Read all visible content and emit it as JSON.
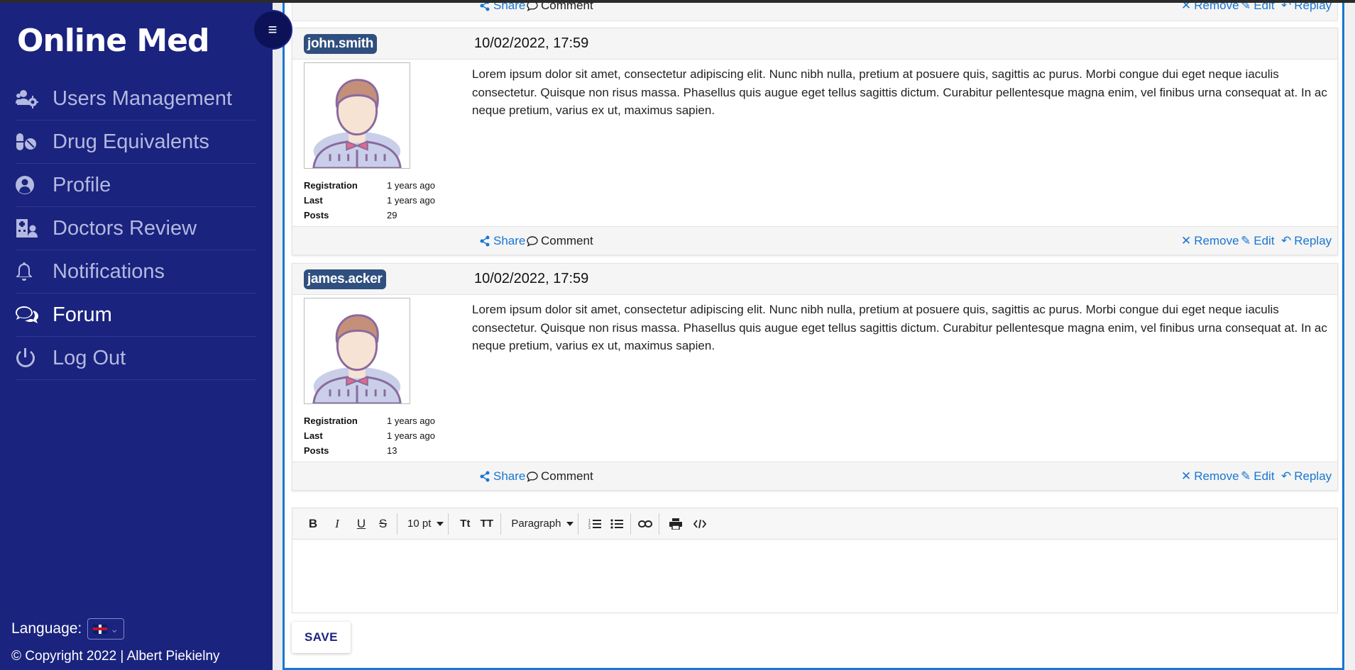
{
  "app": {
    "brand": "Online Med"
  },
  "sidebar": {
    "toggle_icon": "≡",
    "items": [
      {
        "label": "Users Management",
        "icon": "users-cog-icon"
      },
      {
        "label": "Drug Equivalents",
        "icon": "pills-icon"
      },
      {
        "label": "Profile",
        "icon": "user-circle-icon"
      },
      {
        "label": "Doctors Review",
        "icon": "clinic-icon"
      },
      {
        "label": "Notifications",
        "icon": "bell-icon"
      },
      {
        "label": "Forum",
        "icon": "comments-icon",
        "active": true
      },
      {
        "label": "Log Out",
        "icon": "power-icon"
      }
    ],
    "language_label": "Language:",
    "language_flag": "gb-flag-icon",
    "copyright": "© Copyright 2022 | Albert Piekielny"
  },
  "actions": {
    "share": "Share",
    "comment": "Comment",
    "remove": "Remove",
    "edit": "Edit",
    "reply": "Replay"
  },
  "posts": [
    {
      "username": "john.smith",
      "date": "10/02/2022, 17:59",
      "text": "Lorem ipsum dolor sit amet, consectetur adipiscing elit. Nunc nibh nulla, pretium at posuere quis, sagittis ac purus. Morbi congue dui eget neque iaculis consectetur. Quisque non risus massa. Phasellus quis augue eget tellus sagittis dictum. Curabitur pellentesque magna enim, vel finibus urna consequat at. In ac neque pretium, varius ex ut, maximus sapien.",
      "stats": [
        {
          "label": "Registration",
          "value": "1 years ago"
        },
        {
          "label": "Last",
          "value": "1 years ago"
        },
        {
          "label": "Posts",
          "value": "29"
        }
      ]
    },
    {
      "username": "james.acker",
      "date": "10/02/2022, 17:59",
      "text": "Lorem ipsum dolor sit amet, consectetur adipiscing elit. Nunc nibh nulla, pretium at posuere quis, sagittis ac purus. Morbi congue dui eget neque iaculis consectetur. Quisque non risus massa. Phasellus quis augue eget tellus sagittis dictum. Curabitur pellentesque magna enim, vel finibus urna consequat at. In ac neque pretium, varius ex ut, maximus sapien.",
      "stats": [
        {
          "label": "Registration",
          "value": "1 years ago"
        },
        {
          "label": "Last",
          "value": "1 years ago"
        },
        {
          "label": "Posts",
          "value": "13"
        }
      ]
    }
  ],
  "editor": {
    "bold": "B",
    "italic": "I",
    "underline": "U",
    "strike": "S",
    "font_size": "10 pt",
    "subscript": "Tt",
    "superscript": "TT",
    "block_format": "Paragraph",
    "value": ""
  },
  "save_label": "SAVE",
  "colors": {
    "sidebar": "#1a237e",
    "accent": "#1976d2",
    "username_badge": "#2f4f7f"
  }
}
